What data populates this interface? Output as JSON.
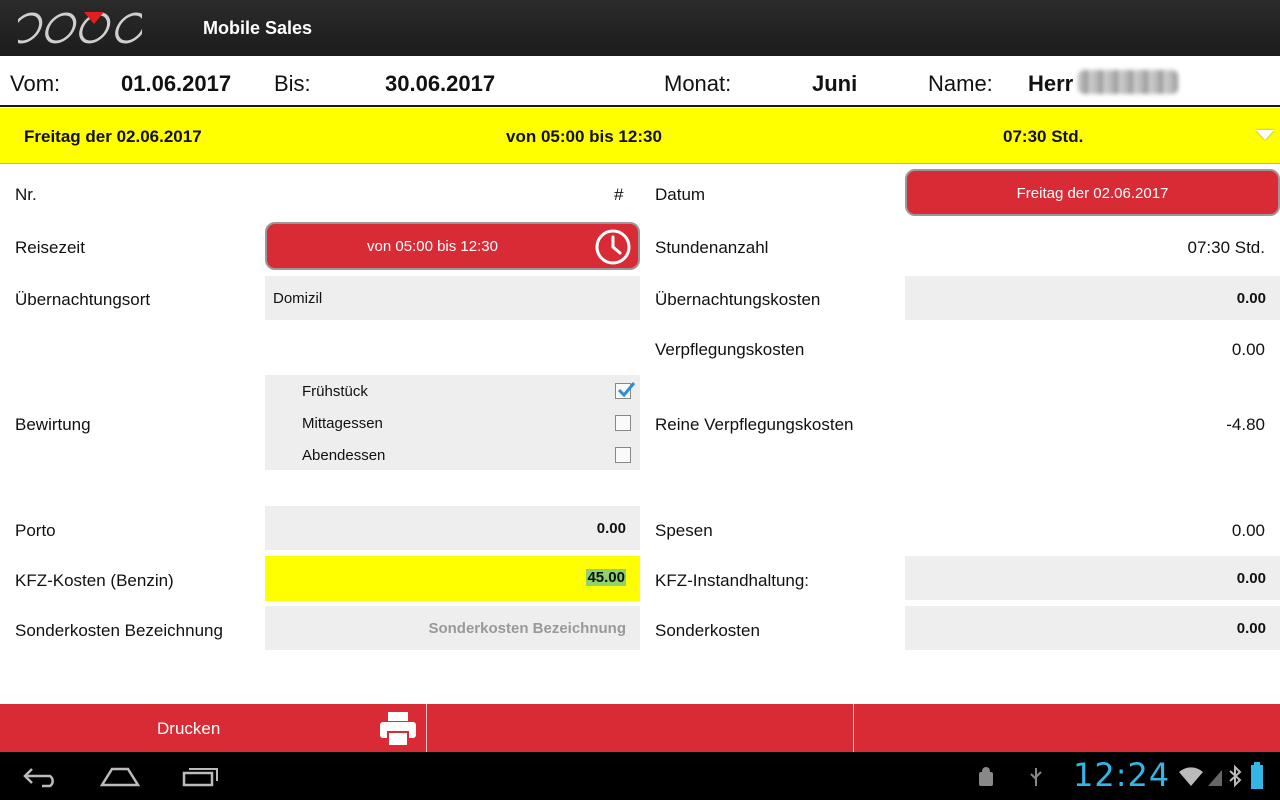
{
  "app": {
    "title": "Mobile Sales"
  },
  "header": {
    "from_label": "Vom:",
    "from_value": "01.06.2017",
    "to_label": "Bis:",
    "to_value": "30.06.2017",
    "month_label": "Monat:",
    "month_value": "Juni",
    "name_label": "Name:",
    "name_value": "Herr"
  },
  "summary": {
    "day": "Freitag der 02.06.2017",
    "time": "von  05:00  bis  12:30",
    "hours": "07:30 Std."
  },
  "form": {
    "nr_label": "Nr.",
    "nr_value": "#",
    "datum_label": "Datum",
    "datum_value": "Freitag der 02.06.2017",
    "reisezeit_label": "Reisezeit",
    "reisezeit_value": "von  05:00  bis  12:30",
    "stunden_label": "Stundenanzahl",
    "stunden_value": "07:30 Std.",
    "ort_label": "Übernachtungsort",
    "ort_value": "Domizil",
    "uekosten_label": "Übernachtungskosten",
    "uekosten_value": "0.00",
    "verpfl_label": "Verpflegungskosten",
    "verpfl_value": "0.00",
    "bewirtung_label": "Bewirtung",
    "meals": [
      {
        "label": "Frühstück",
        "checked": true
      },
      {
        "label": "Mittagessen",
        "checked": false
      },
      {
        "label": "Abendessen",
        "checked": false
      }
    ],
    "reine_label": "Reine Verpflegungskosten",
    "reine_value": "-4.80",
    "porto_label": "Porto",
    "porto_value": "0.00",
    "spesen_label": "Spesen",
    "spesen_value": "0.00",
    "kfz_label": "KFZ-Kosten (Benzin)",
    "kfz_value": "45.00",
    "kfz_inst_label": "KFZ-Instandhaltung:",
    "kfz_inst_value": "0.00",
    "sonder_bez_label": "Sonderkosten Bezeichnung",
    "sonder_bez_placeholder": "Sonderkosten Bezeichnung",
    "sonder_label": "Sonderkosten",
    "sonder_value": "0.00"
  },
  "bottom": {
    "print_label": "Drucken"
  },
  "status": {
    "time": "12:24"
  },
  "colors": {
    "accent_red": "#d92b35",
    "highlight_yellow": "#ffff00",
    "clock_blue": "#33b5e5"
  }
}
